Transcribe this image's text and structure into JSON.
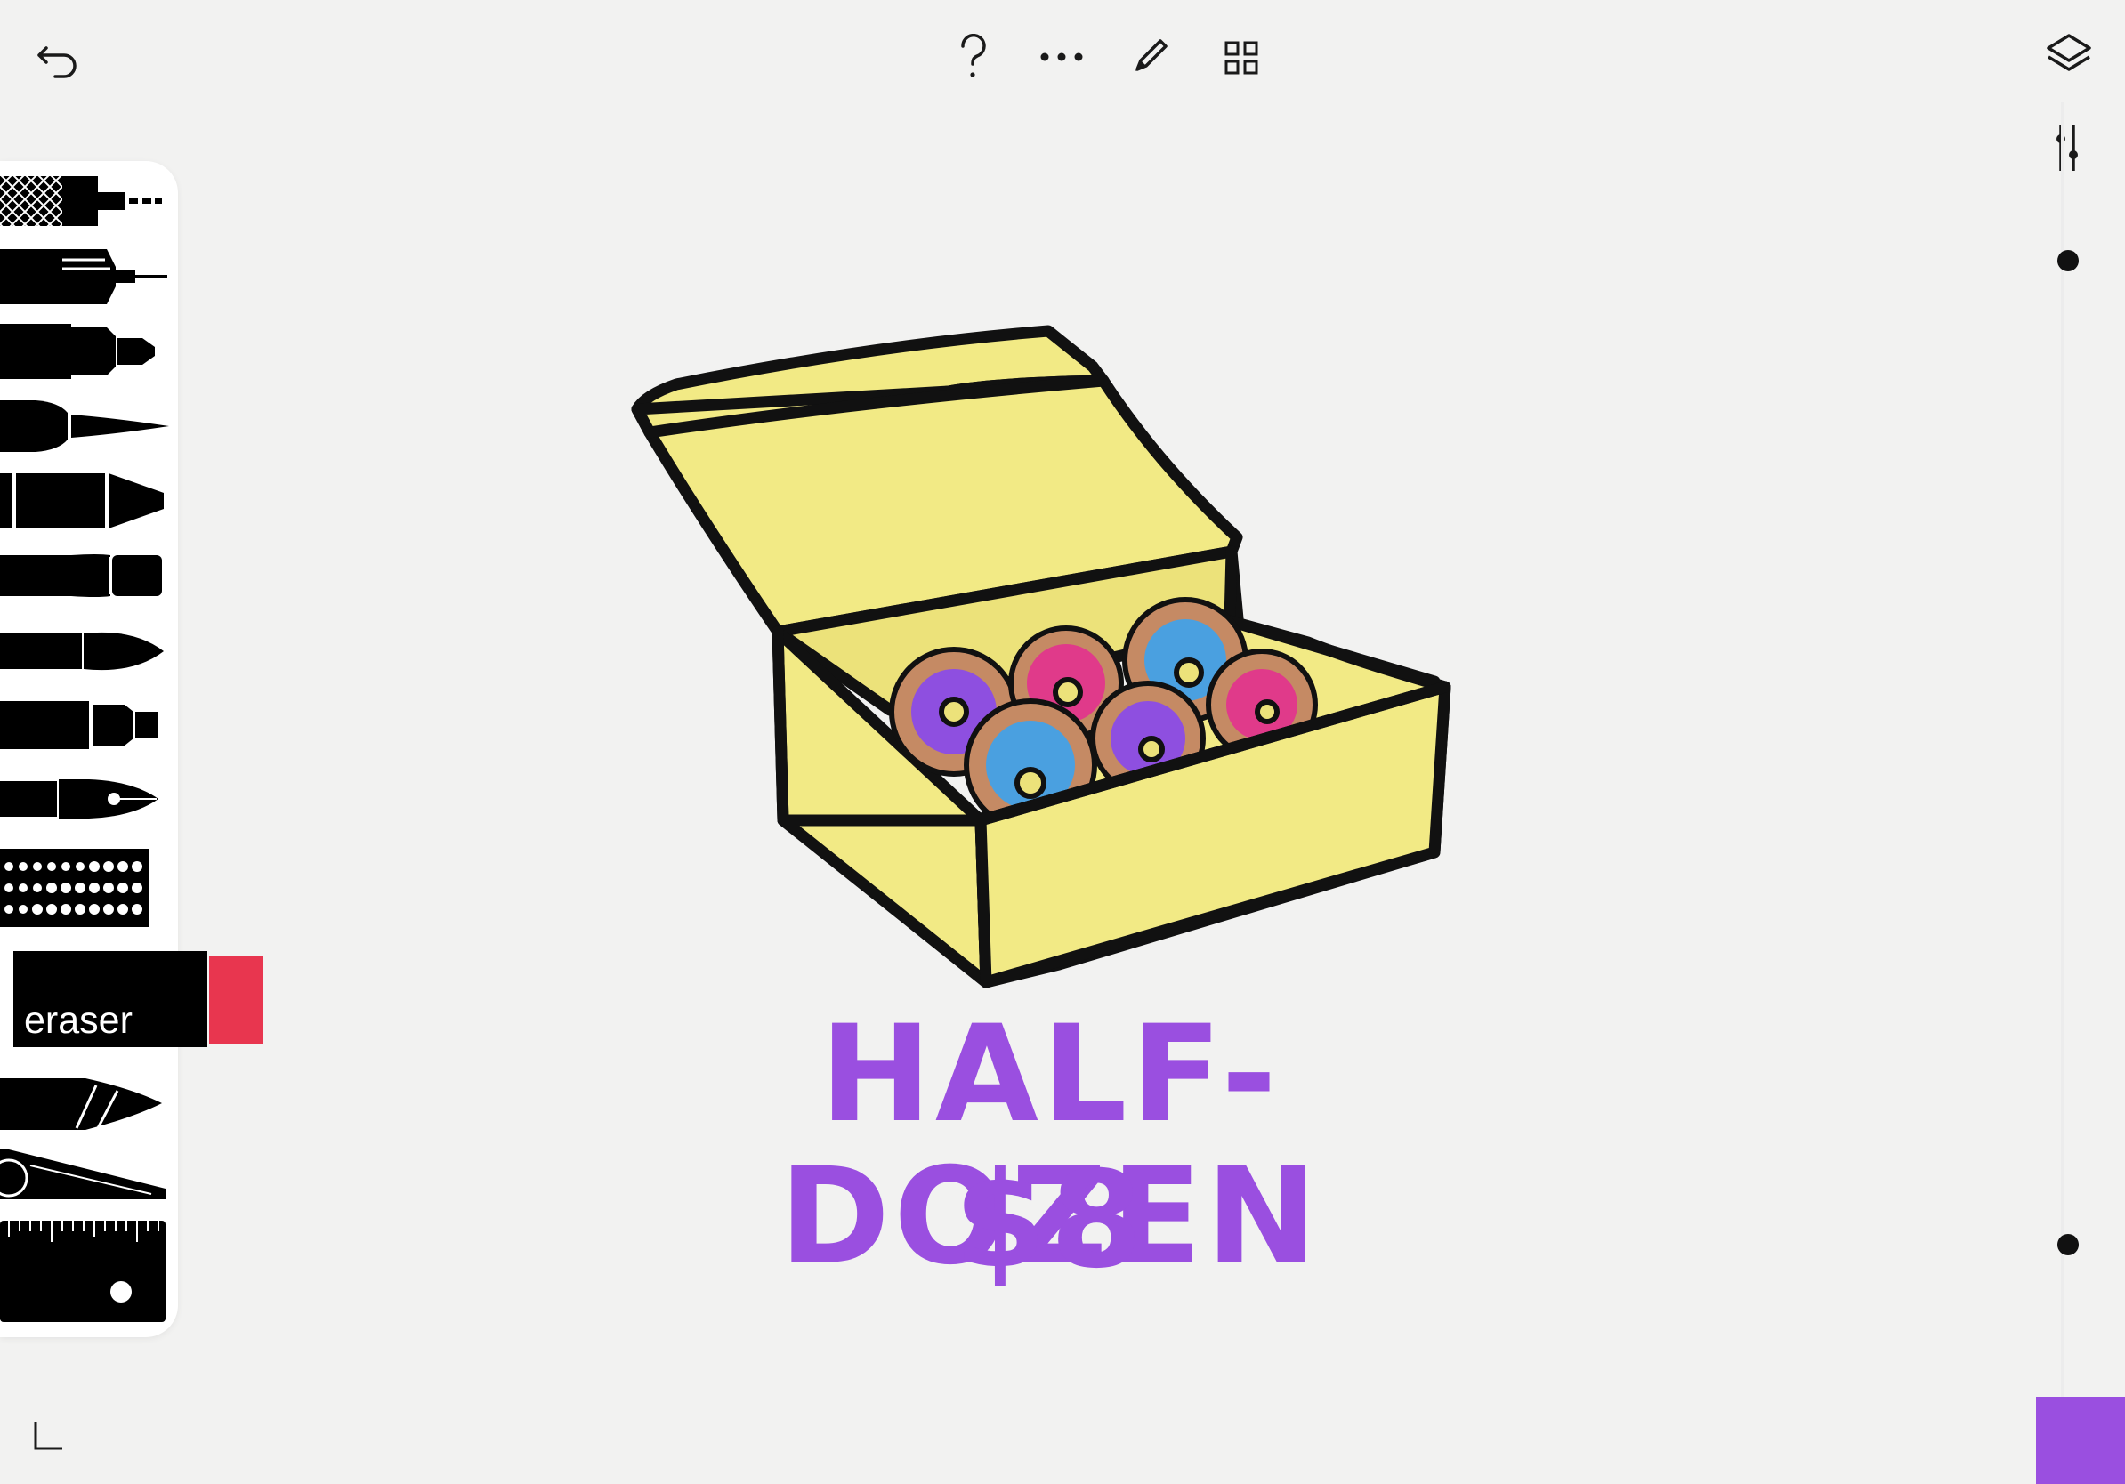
{
  "toolbar": {
    "back_icon": "undo-arrow-icon",
    "help_icon": "question-mark-icon",
    "more_icon": "more-dots-icon",
    "pen_icon": "pencil-icon",
    "gallery_icon": "grid-icon",
    "layers_icon": "layers-icon",
    "adjust_icon": "sliders-icon"
  },
  "tools": {
    "eraser_label": "eraser",
    "eraser_tip_color": "#e8364f"
  },
  "artwork": {
    "headline": "HALF-DOZEN",
    "price": "$8",
    "text_color": "#9a4fe0",
    "box_color": "#f2ea85"
  },
  "current_color": "#9a4fe0"
}
